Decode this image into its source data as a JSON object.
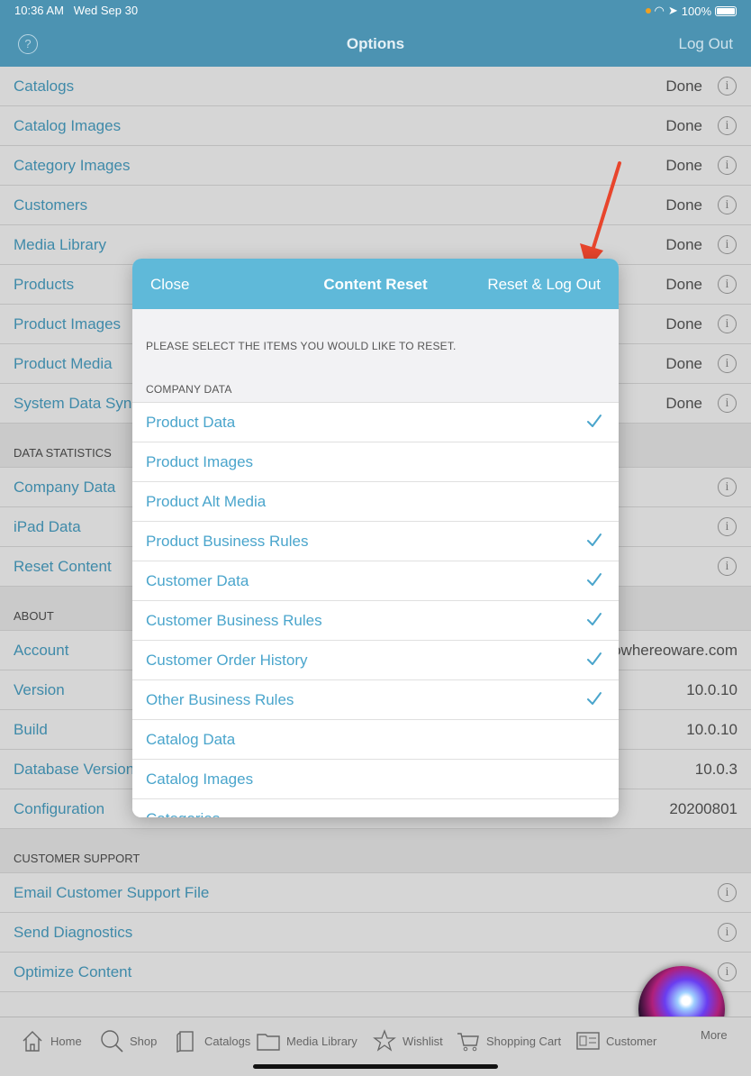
{
  "status": {
    "time": "10:36 AM",
    "date": "Wed Sep 30",
    "battery": "100%"
  },
  "nav": {
    "help": "?",
    "title": "Options",
    "logout": "Log Out"
  },
  "sync_rows": [
    {
      "label": "Catalogs",
      "value": "Done"
    },
    {
      "label": "Catalog Images",
      "value": "Done"
    },
    {
      "label": "Category Images",
      "value": "Done"
    },
    {
      "label": "Customers",
      "value": "Done"
    },
    {
      "label": "Media Library",
      "value": "Done"
    },
    {
      "label": "Products",
      "value": "Done"
    },
    {
      "label": "Product Images",
      "value": "Done"
    },
    {
      "label": "Product Media",
      "value": "Done"
    },
    {
      "label": "System Data Sync",
      "value": "Done"
    }
  ],
  "data_statistics": {
    "header": "DATA STATISTICS",
    "rows": [
      "Company Data",
      "iPad Data",
      "Reset Content"
    ]
  },
  "about": {
    "header": "ABOUT",
    "rows": [
      {
        "label": "Account",
        "value": "owhereoware.com"
      },
      {
        "label": "Version",
        "value": "10.0.10"
      },
      {
        "label": "Build",
        "value": "10.0.10"
      },
      {
        "label": "Database Version",
        "value": "10.0.3"
      },
      {
        "label": "Configuration",
        "value": "20200801"
      }
    ]
  },
  "customer_support": {
    "header": "CUSTOMER SUPPORT",
    "rows": [
      "Email Customer Support File",
      "Send Diagnostics",
      "Optimize Content"
    ]
  },
  "info_glyph": "i",
  "tabs": [
    "Home",
    "Shop",
    "Catalogs",
    "Media Library",
    "Wishlist",
    "Shopping Cart",
    "Customer",
    "More"
  ],
  "modal": {
    "close": "Close",
    "title": "Content Reset",
    "reset": "Reset & Log Out",
    "instruction": "PLEASE SELECT THE ITEMS YOU WOULD LIKE TO RESET.",
    "section": "COMPANY DATA",
    "items": [
      {
        "label": "Product Data",
        "checked": true
      },
      {
        "label": "Product Images",
        "checked": false
      },
      {
        "label": "Product Alt Media",
        "checked": false
      },
      {
        "label": "Product Business Rules",
        "checked": true
      },
      {
        "label": "Customer Data",
        "checked": true
      },
      {
        "label": "Customer Business Rules",
        "checked": true
      },
      {
        "label": "Customer Order History",
        "checked": true
      },
      {
        "label": "Other Business Rules",
        "checked": true
      },
      {
        "label": "Catalog Data",
        "checked": false
      },
      {
        "label": "Catalog Images",
        "checked": false
      },
      {
        "label": "Categories",
        "checked": false
      }
    ]
  },
  "colors": {
    "nav": "#4c93b2",
    "modal_header": "#5fb9d9",
    "link": "#4aa5cc",
    "arrow": "#e8452c"
  }
}
